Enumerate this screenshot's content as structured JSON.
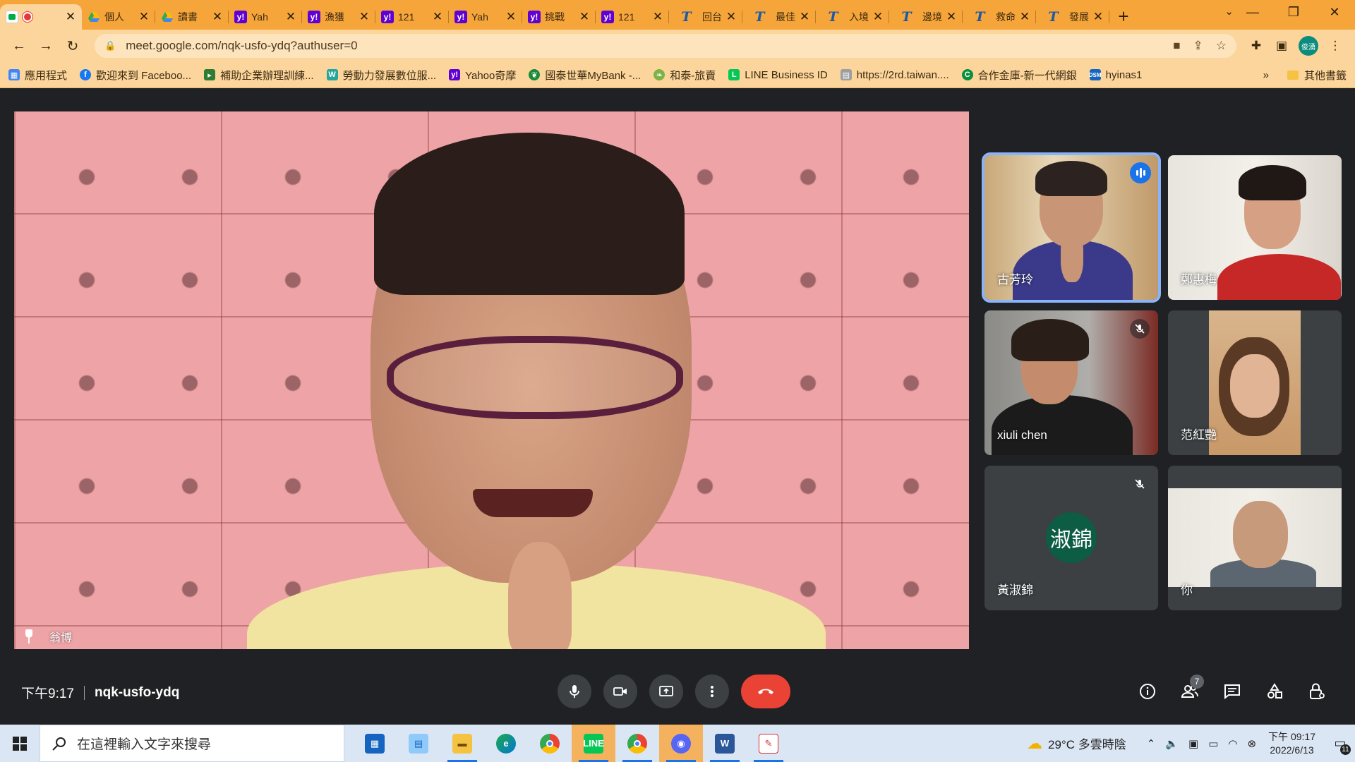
{
  "browser": {
    "tabs": [
      {
        "favicon": "meet-icon",
        "title": "",
        "active": true
      },
      {
        "favicon": "drive-icon",
        "title": "個人"
      },
      {
        "favicon": "drive-icon",
        "title": "讀書"
      },
      {
        "favicon": "yahoo-icon",
        "title": "Yah"
      },
      {
        "favicon": "yahoo-icon",
        "title": "漁獲"
      },
      {
        "favicon": "yahoo-icon",
        "title": "121"
      },
      {
        "favicon": "yahoo-icon",
        "title": "Yah"
      },
      {
        "favicon": "yahoo-icon",
        "title": "挑戰"
      },
      {
        "favicon": "yahoo-icon",
        "title": "121"
      },
      {
        "favicon": "t-icon",
        "title": "回台"
      },
      {
        "favicon": "t-icon",
        "title": "最佳"
      },
      {
        "favicon": "t-icon",
        "title": "入境"
      },
      {
        "favicon": "t-icon",
        "title": "邊境"
      },
      {
        "favicon": "t-icon",
        "title": "救命"
      },
      {
        "favicon": "t-icon",
        "title": "發展"
      }
    ],
    "url": "meet.google.com/nqk-usfo-ydq?authuser=0",
    "profile_label": "俊湧",
    "bookmarks": [
      {
        "icon": "apps-grid-icon",
        "label": "應用程式",
        "color": "#4285f4"
      },
      {
        "icon": "facebook-icon",
        "label": "歡迎來到 Faceboo...",
        "color": "#1877f2"
      },
      {
        "icon": "flag-icon",
        "label": "補助企業辦理訓練...",
        "color": "#2e7d32"
      },
      {
        "icon": "w-icon",
        "label": "勞動力發展數位服...",
        "color": "#26a69a"
      },
      {
        "icon": "yahoo-icon",
        "label": "Yahoo奇摩",
        "color": "#6001d2"
      },
      {
        "icon": "leaf-icon",
        "label": "國泰世華MyBank -...",
        "color": "#1b8a3a"
      },
      {
        "icon": "leaf-icon",
        "label": "和泰-旅賣",
        "color": "#7cb342"
      },
      {
        "icon": "line-icon",
        "label": "LINE Business ID",
        "color": "#06c755"
      },
      {
        "icon": "page-icon",
        "label": "https://2rd.taiwan....",
        "color": "#9e9e9e"
      },
      {
        "icon": "bank-icon",
        "label": "合作金庫-新一代網銀",
        "color": "#0a8f3c"
      },
      {
        "icon": "dsm-icon",
        "label": "hyinas1",
        "color": "#1565c0"
      }
    ],
    "bookmarks_more": "»",
    "other_bookmarks": "其他書籤"
  },
  "meet": {
    "main_speaker": "翁博",
    "participants": [
      {
        "name": "古芳玲",
        "speaking": true,
        "muted": false
      },
      {
        "name": "鄭惠梅",
        "speaking": false,
        "muted": false
      },
      {
        "name": "xiuli chen",
        "speaking": false,
        "muted": true
      },
      {
        "name": "范紅艷",
        "speaking": false,
        "muted": false
      },
      {
        "name": "黃淑錦",
        "speaking": false,
        "muted": true,
        "avatar_text": "淑錦"
      },
      {
        "name": "你",
        "speaking": false,
        "muted": false
      }
    ],
    "time": "下午9:17",
    "meeting_code": "nqk-usfo-ydq",
    "people_count": "7"
  },
  "taskbar": {
    "search_placeholder": "在這裡輸入文字來搜尋",
    "weather": "29°C  多雲時陰",
    "clock_time": "下午 09:17",
    "clock_date": "2022/6/13",
    "notification_count": "11"
  },
  "colors": {
    "chrome_orange": "#f6a53a",
    "meet_bg": "#202124",
    "hangup_red": "#ea4335",
    "speaking_blue": "#8ab4f8"
  }
}
